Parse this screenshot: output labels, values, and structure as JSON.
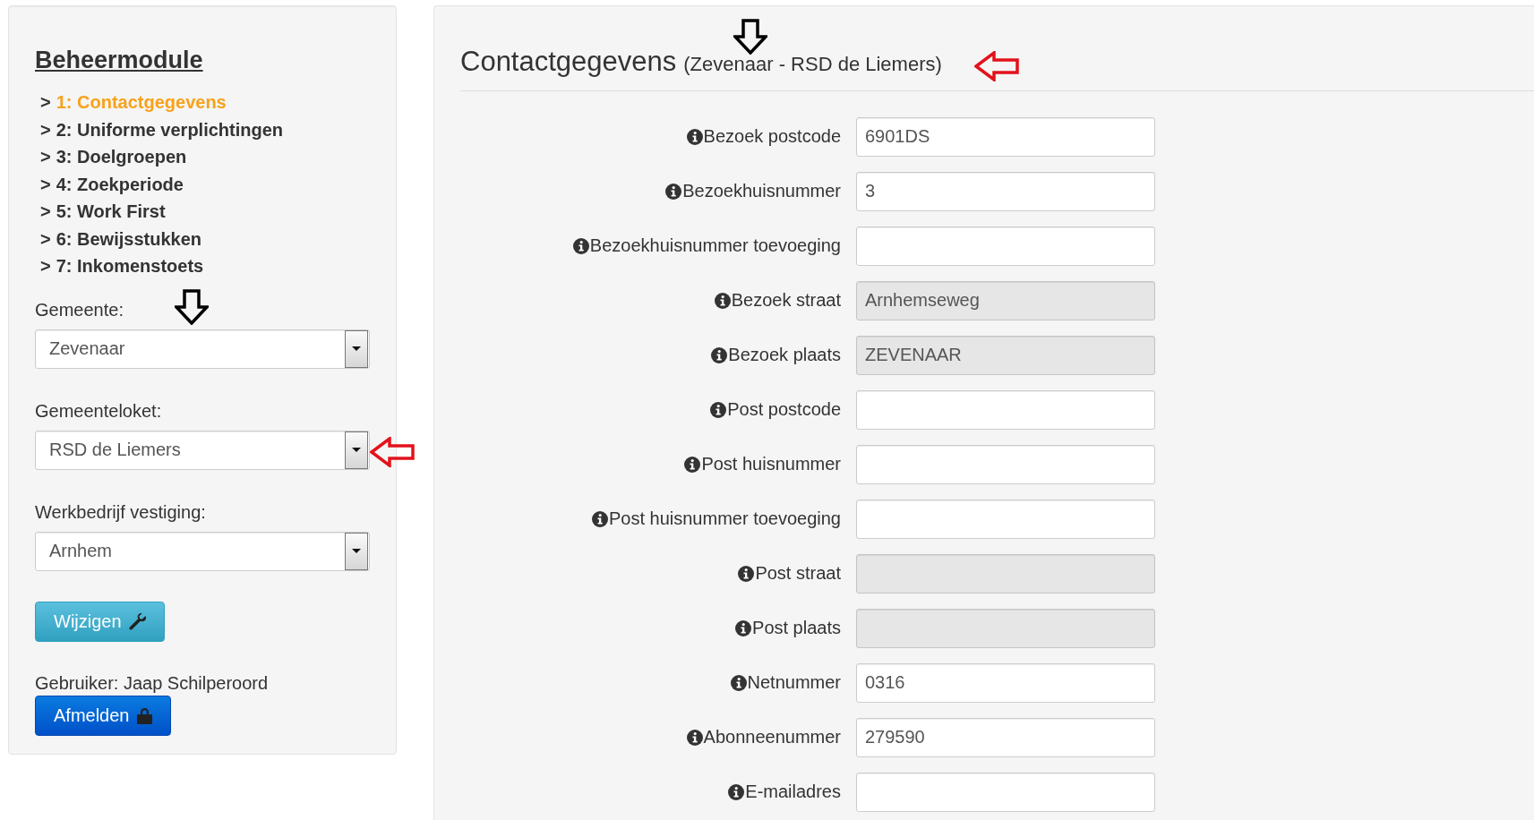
{
  "sidebar": {
    "title": "Beheermodule",
    "nav": [
      {
        "marker": ">",
        "label": "1: Contactgegevens",
        "selected": true
      },
      {
        "marker": ">",
        "label": "2: Uniforme verplichtingen",
        "selected": false
      },
      {
        "marker": ">",
        "label": "3: Doelgroepen",
        "selected": false
      },
      {
        "marker": ">",
        "label": "4: Zoekperiode",
        "selected": false
      },
      {
        "marker": ">",
        "label": "5: Work First",
        "selected": false
      },
      {
        "marker": ">",
        "label": "6: Bewijsstukken",
        "selected": false
      },
      {
        "marker": ">",
        "label": "7: Inkomenstoets",
        "selected": false
      }
    ],
    "selects": [
      {
        "label": "Gemeente:",
        "value": "Zevenaar"
      },
      {
        "label": "Gemeenteloket:",
        "value": "RSD de Liemers"
      },
      {
        "label": "Werkbedrijf vestiging:",
        "value": "Arnhem"
      }
    ],
    "edit_button": "Wijzigen",
    "user": "Gebruiker: Jaap Schilperoord",
    "logout_button": "Afmelden"
  },
  "main": {
    "title": "Contactgegevens",
    "subtitle": "(Zevenaar - RSD de Liemers)",
    "fields": [
      {
        "label": "Bezoek postcode",
        "value": "6901DS",
        "disabled": false
      },
      {
        "label": "Bezoekhuisnummer",
        "value": "3",
        "disabled": false
      },
      {
        "label": "Bezoekhuisnummer toevoeging",
        "disabled": false
      },
      {
        "label": "Bezoek straat",
        "value": "Arnhemseweg",
        "disabled": true
      },
      {
        "label": "Bezoek plaats",
        "value": "ZEVENAAR",
        "disabled": true
      },
      {
        "label": "Post postcode",
        "disabled": false
      },
      {
        "label": "Post huisnummer",
        "disabled": false
      },
      {
        "label": "Post huisnummer toevoeging",
        "disabled": false
      },
      {
        "label": "Post straat",
        "disabled": true
      },
      {
        "label": "Post plaats",
        "disabled": true
      },
      {
        "label": "Netnummer",
        "value": "0316",
        "disabled": false
      },
      {
        "label": "Abonneenummer",
        "value": "279590",
        "disabled": false
      },
      {
        "label": "E-mailadres",
        "disabled": false
      }
    ]
  }
}
